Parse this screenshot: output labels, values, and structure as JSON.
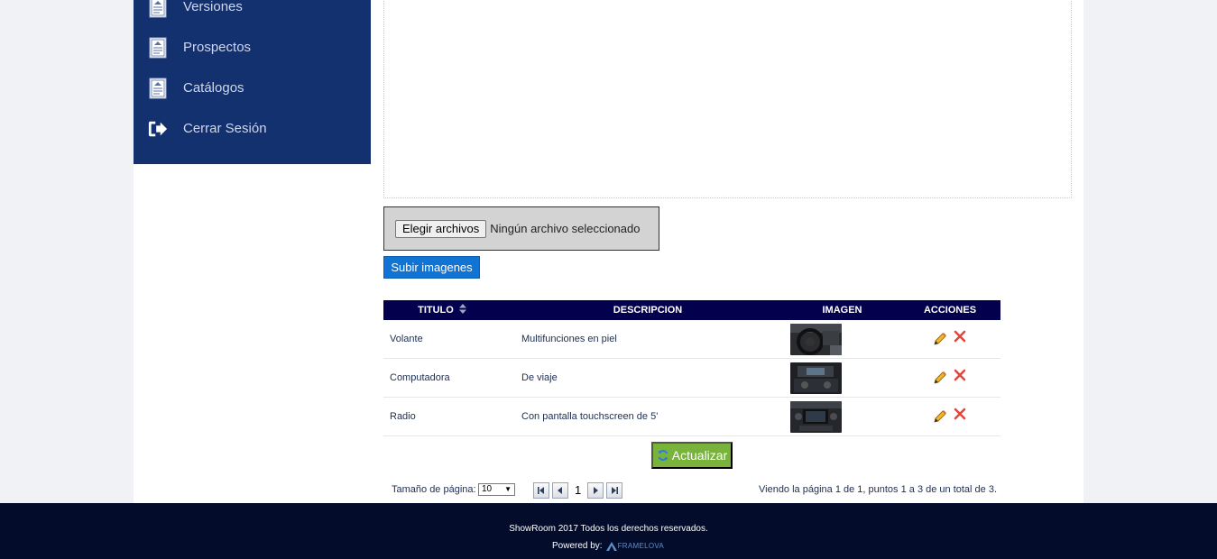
{
  "sidebar": {
    "items": [
      {
        "label": "Versiones",
        "icon": "document-icon"
      },
      {
        "label": "Prospectos",
        "icon": "document-icon"
      },
      {
        "label": "Catálogos",
        "icon": "document-icon"
      },
      {
        "label": "Cerrar Sesión",
        "icon": "logout-icon"
      }
    ]
  },
  "upload": {
    "choose_label": "Elegir archivos",
    "no_file_text": "Ningún archivo seleccionado",
    "submit_label": "Subir imagenes"
  },
  "grid": {
    "columns": [
      "TITULO",
      "DESCRIPCION",
      "IMAGEN",
      "ACCIONES"
    ],
    "rows": [
      {
        "titulo": "Volante",
        "descripcion": "Multifunciones en piel",
        "imagen": "steering-wheel-photo"
      },
      {
        "titulo": "Computadora",
        "descripcion": "De viaje",
        "imagen": "dashboard-computer-photo"
      },
      {
        "titulo": "Radio",
        "descripcion": "Con pantalla touchscreen de 5'",
        "imagen": "radio-photo"
      }
    ],
    "refresh_label": "Actualizar"
  },
  "pager": {
    "size_label": "Tamaño de página:",
    "size_value": "10",
    "current_page": "1",
    "info": "Viendo la página 1 de 1, puntos 1 a 3 de un total de 3."
  },
  "footer": {
    "copyright": "ShowRoom 2017 Todos los derechos reservados.",
    "powered_by": "Powered by:",
    "brand": "FRAMELOVA"
  },
  "colors": {
    "sidebar_bg": "#13306f",
    "grid_header_bg": "#03004d",
    "upload_button": "#1173d4",
    "refresh_button": "#79b33b",
    "footer_bg": "#030d2b",
    "delete_icon": "#e0483e"
  }
}
